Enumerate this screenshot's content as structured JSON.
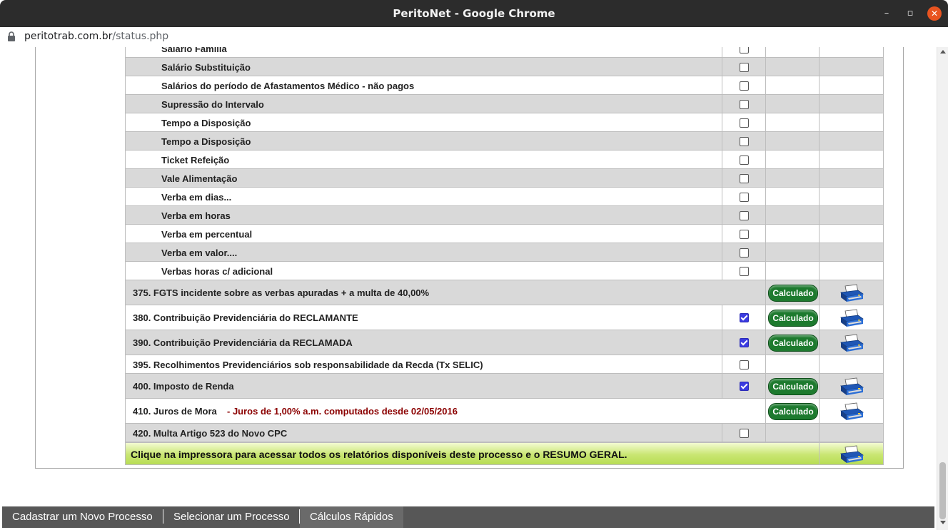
{
  "window": {
    "title": "PeritoNet - Google Chrome"
  },
  "address": {
    "host": "peritotrab.com.br",
    "path": "/status.php"
  },
  "rows": [
    {
      "label": "Salário Família",
      "style": "w",
      "type": "sub",
      "checked": false
    },
    {
      "label": "Salário Substituição",
      "style": "g",
      "type": "sub",
      "checked": false
    },
    {
      "label": "Salários do período de Afastamentos Médico - não pagos",
      "style": "w",
      "type": "sub",
      "checked": false
    },
    {
      "label": "Supressão do Intervalo",
      "style": "g",
      "type": "sub",
      "checked": false
    },
    {
      "label": "Tempo a Disposição",
      "style": "w",
      "type": "sub",
      "checked": false
    },
    {
      "label": "Tempo a Disposição",
      "style": "g",
      "type": "sub",
      "checked": false
    },
    {
      "label": "Ticket Refeição",
      "style": "w",
      "type": "sub",
      "checked": false
    },
    {
      "label": "Vale Alimentação",
      "style": "g",
      "type": "sub",
      "checked": false
    },
    {
      "label": "Verba em dias...",
      "style": "w",
      "type": "sub",
      "checked": false
    },
    {
      "label": "Verba em horas",
      "style": "g",
      "type": "sub",
      "checked": false
    },
    {
      "label": "Verba em percentual",
      "style": "w",
      "type": "sub",
      "checked": false
    },
    {
      "label": "Verba em valor....",
      "style": "g",
      "type": "sub",
      "checked": false
    },
    {
      "label": "Verbas horas c/ adicional",
      "style": "w",
      "type": "sub",
      "checked": false
    },
    {
      "label": "375. FGTS incidente sobre as verbas apuradas + a multa de 40,00%",
      "style": "g",
      "type": "main",
      "checkbox": false,
      "checked": false,
      "status": "Calculado",
      "printer": true
    },
    {
      "label": "380. Contribuição Previdenciária do RECLAMANTE",
      "style": "w",
      "type": "main",
      "checkbox": true,
      "checked": true,
      "status": "Calculado",
      "printer": true
    },
    {
      "label": "390. Contribuição Previdenciária da RECLAMADA",
      "style": "g",
      "type": "main",
      "checkbox": true,
      "checked": true,
      "status": "Calculado",
      "printer": true
    },
    {
      "label": "395. Recolhimentos Previdenciários sob responsabilidade da Recda (Tx SELIC)",
      "style": "w",
      "type": "main",
      "checkbox": true,
      "checked": false,
      "status": "",
      "printer": false
    },
    {
      "label": "400. Imposto de Renda",
      "style": "g",
      "type": "main",
      "checkbox": true,
      "checked": true,
      "status": "Calculado",
      "printer": true
    },
    {
      "label": "410. Juros de Mora",
      "note": "-  Juros de 1,00% a.m. computados desde 02/05/2016",
      "style": "w",
      "type": "main",
      "checkbox": false,
      "checked": false,
      "status": "Calculado",
      "printer": true
    },
    {
      "label": "420. Multa Artigo 523 do Novo CPC",
      "style": "g",
      "type": "main",
      "checkbox": true,
      "checked": false,
      "status": "",
      "printer": false
    }
  ],
  "footer": {
    "text": "Clique na impressora para acessar todos os relatórios disponíveis deste processo e o RESUMO GERAL."
  },
  "nav": {
    "new_process": "Cadastrar um Novo Processo",
    "select_process": "Selecionar um Processo",
    "quick_calc": "Cálculos Rápidos"
  },
  "colors": {
    "calculado_badge": "#1d7a2e",
    "gray_row": "#d9d9d9",
    "note_text": "#8b0000",
    "footer_green": "#c9e672",
    "bottom_nav": "#575757"
  }
}
